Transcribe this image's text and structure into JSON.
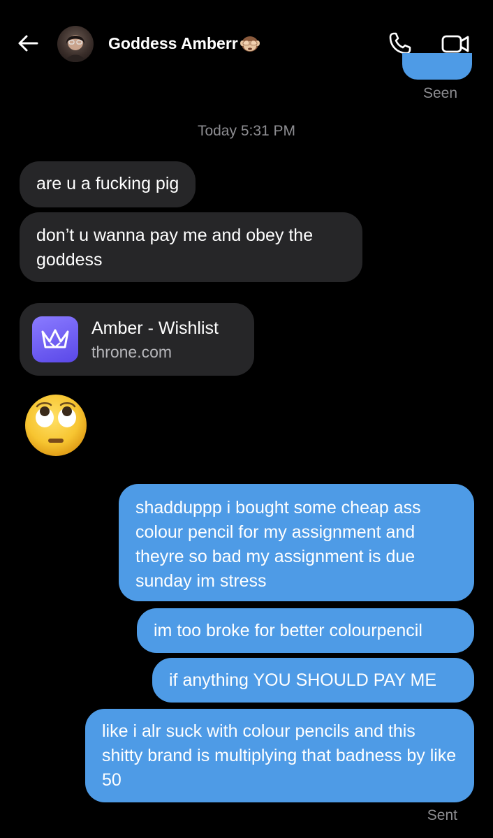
{
  "header": {
    "contact_name": "Goddess Amberr",
    "name_emoji": "see-no-evil-monkey-icon"
  },
  "status": {
    "seen": "Seen",
    "sent": "Sent"
  },
  "timestamp": "Today 5:31 PM",
  "messages": {
    "incoming": [
      "are u a fucking pig",
      "don’t u wanna pay me and obey the goddess"
    ],
    "link_card": {
      "title": "Amber - Wishlist",
      "domain": "throne.com"
    },
    "emoji_reply": "face-with-rolling-eyes-icon",
    "outgoing": [
      "shadduppp i bought some cheap ass colour pencil for my assignment and theyre so bad my assignment is due sunday im stress",
      "im too broke for better colourpencil",
      "if anything YOU SHOULD PAY ME",
      "like i alr suck with colour pencils and this shitty brand is multiplying that badness by like 50"
    ]
  },
  "colors": {
    "background": "#000000",
    "incoming_bubble": "#262628",
    "outgoing_bubble": "#4e9be6",
    "muted_text": "#8d8d91"
  }
}
